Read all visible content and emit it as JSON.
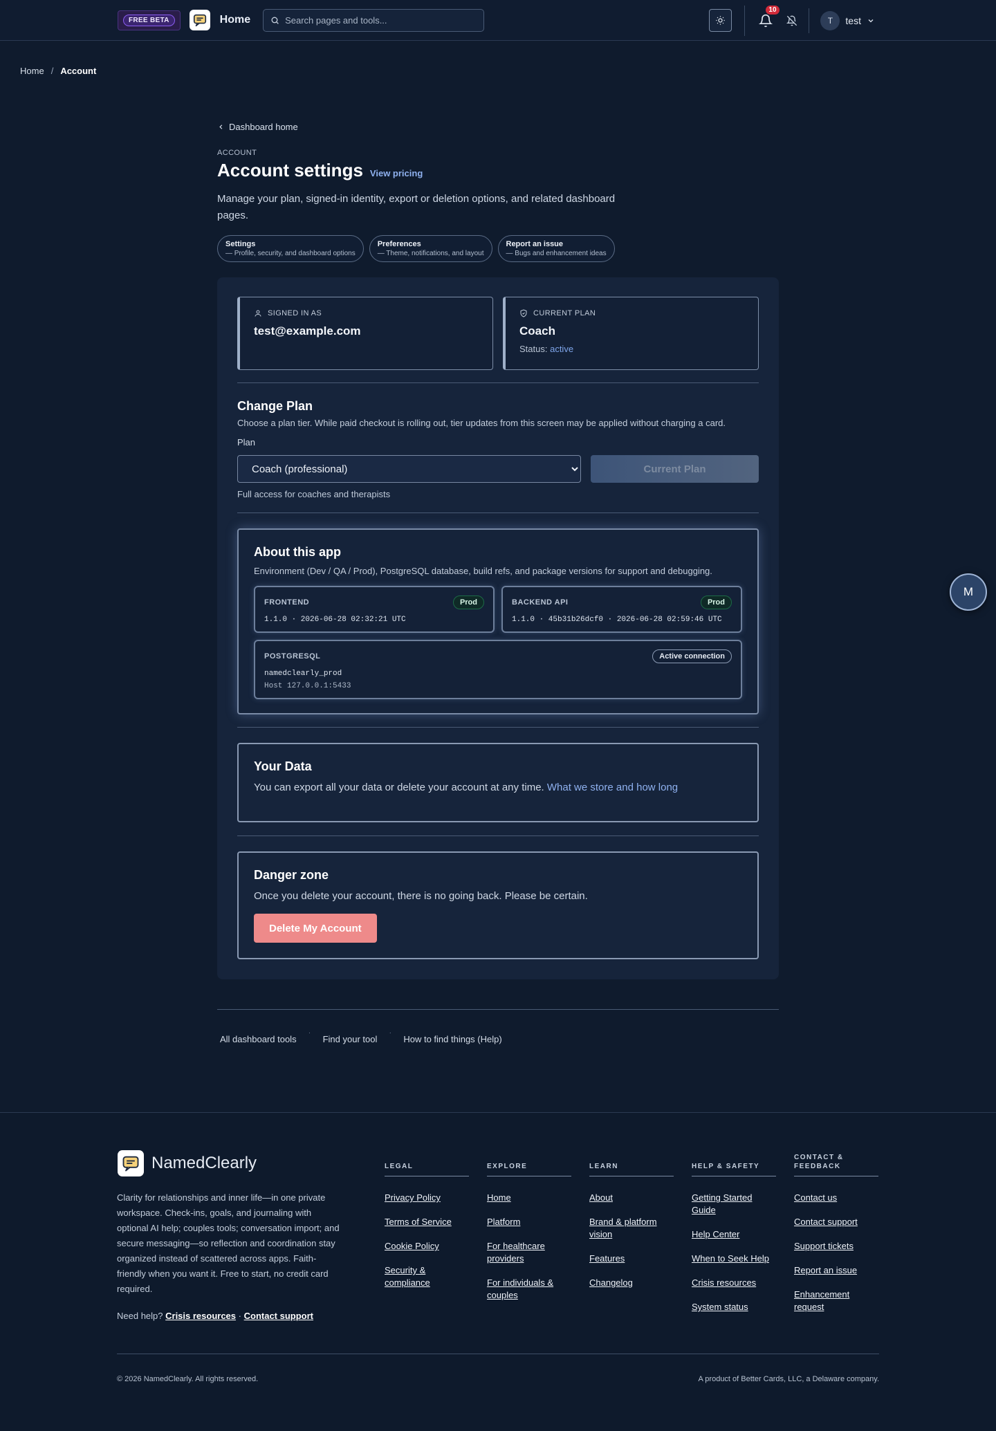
{
  "topbar": {
    "beta_badge": "FREE BETA",
    "home_label": "Home",
    "search_placeholder": "Search pages and tools...",
    "notification_count": "10",
    "user_initial": "T",
    "user_name": "test"
  },
  "breadcrumb": {
    "home": "Home",
    "separator": "/",
    "current": "Account"
  },
  "main": {
    "back_link": "Dashboard home",
    "eyebrow": "ACCOUNT",
    "title": "Account settings",
    "view_pricing": "View pricing",
    "intro": "Manage your plan, signed-in identity, export or deletion options, and related dashboard pages.",
    "pills": [
      {
        "title": "Settings",
        "desc": "— Profile, security, and dashboard options"
      },
      {
        "title": "Preferences",
        "desc": "— Theme, notifications, and layout"
      },
      {
        "title": "Report an issue",
        "desc": "— Bugs and enhancement ideas"
      }
    ]
  },
  "account_card": {
    "signed_in_label": "SIGNED IN AS",
    "email": "test@example.com",
    "current_plan_label": "CURRENT PLAN",
    "plan_name": "Coach",
    "status_label": "Status:",
    "status_value": "active"
  },
  "change_plan": {
    "title": "Change Plan",
    "desc": "Choose a plan tier. While paid checkout is rolling out, tier updates from this screen may be applied without charging a card.",
    "plan_label": "Plan",
    "selected_option": "Coach (professional)",
    "button_label": "Current Plan",
    "note": "Full access for coaches and therapists"
  },
  "about": {
    "title": "About this app",
    "desc": "Environment (Dev / QA / Prod), PostgreSQL database, build refs, and package versions for support and debugging.",
    "frontend": {
      "name": "FRONTEND",
      "badge": "Prod",
      "version": "1.1.0 · 2026-06-28 02:32:21 UTC"
    },
    "backend": {
      "name": "BACKEND API",
      "badge": "Prod",
      "version": "1.1.0 · 45b31b26dcf0 · 2026-06-28 02:59:46 UTC"
    },
    "postgres": {
      "name": "POSTGRESQL",
      "badge": "Active connection",
      "db": "namedclearly_prod",
      "host": "Host 127.0.0.1:5433"
    }
  },
  "your_data": {
    "title": "Your Data",
    "body": "You can export all your data or delete your account at any time.",
    "link": "What we store and how long"
  },
  "danger": {
    "title": "Danger zone",
    "body": "Once you delete your account, there is no going back. Please be certain.",
    "button": "Delete My Account"
  },
  "tool_links": [
    "All dashboard tools",
    "Find your tool",
    "How to find things (Help)"
  ],
  "fab_label": "M",
  "footer": {
    "brand": "NamedClearly",
    "tagline": "Clarity for relationships and inner life—in one private workspace. Check-ins, goals, and journaling with optional AI help; couples tools; conversation import; and secure messaging—so reflection and coordination stay organized instead of scattered across apps. Faith-friendly when you want it. Free to start, no credit card required.",
    "help_prefix": "Need help?",
    "help_crisis": "Crisis resources",
    "help_dot": "·",
    "help_support": "Contact support",
    "columns": [
      {
        "title": "LEGAL",
        "links": [
          "Privacy Policy",
          "Terms of Service",
          "Cookie Policy",
          "Security & compliance"
        ]
      },
      {
        "title": "EXPLORE",
        "links": [
          "Home",
          "Platform",
          "For healthcare providers",
          "For individuals & couples"
        ]
      },
      {
        "title": "LEARN",
        "links": [
          "About",
          "Brand & platform vision",
          "Features",
          "Changelog"
        ]
      },
      {
        "title": "HELP & SAFETY",
        "links": [
          "Getting Started Guide",
          "Help Center",
          "When to Seek Help",
          "Crisis resources",
          "System status"
        ]
      },
      {
        "title": "CONTACT & FEEDBACK",
        "links": [
          "Contact us",
          "Contact support",
          "Support tickets",
          "Report an issue",
          "Enhancement request"
        ]
      }
    ],
    "copyright": "© 2026 NamedClearly. All rights reserved.",
    "product_of": "A product of Better Cards, LLC, a Delaware company."
  }
}
